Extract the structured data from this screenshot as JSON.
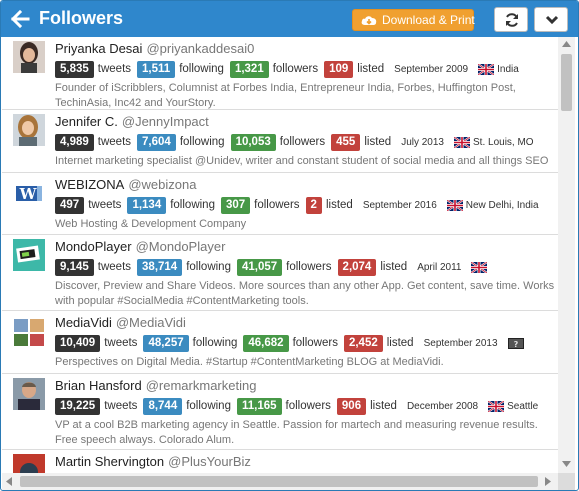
{
  "header": {
    "title": "Followers",
    "download_label": "Download & Print",
    "accent_color": "#2f87cc",
    "download_color": "#f0a030"
  },
  "followers": [
    {
      "name": "Priyanka Desai",
      "handle": "@priyankaddesai0",
      "tweets": "5,835",
      "following": "1,511",
      "followers": "1,321",
      "listed": "109",
      "joined": "September 2009",
      "location": "India",
      "bio": "Founder of iScribblers, Columnist at Forbes India, Entrepreneur India, Forbes, Huffington Post, TechinAsia, Inc42 and YourStory."
    },
    {
      "name": "Jennifer C.",
      "handle": "@JennyImpact",
      "tweets": "4,989",
      "following": "7,604",
      "followers": "10,053",
      "listed": "455",
      "joined": "July 2013",
      "location": "St. Louis, MO",
      "bio": "Internet marketing specialist @Unidev, writer and constant student of social media and all things SEO"
    },
    {
      "name": "WEBIZONA",
      "handle": "@webizona",
      "tweets": "497",
      "following": "1,134",
      "followers": "307",
      "listed": "2",
      "joined": "September 2016",
      "location": "New Delhi, India",
      "bio": "Web Hosting & Development Company"
    },
    {
      "name": "MondoPlayer",
      "handle": "@MondoPlayer",
      "tweets": "9,145",
      "following": "38,714",
      "followers": "41,057",
      "listed": "2,074",
      "joined": "April 2011",
      "location": "",
      "bio": "Discover, Preview and Share Videos. More sources than any other App. Get content, save time. Works with popular #SocialMedia #ContentMarketing tools."
    },
    {
      "name": "MediaVidi",
      "handle": "@MediaVidi",
      "tweets": "10,409",
      "following": "48,257",
      "followers": "46,682",
      "listed": "2,452",
      "joined": "September 2013",
      "location": "",
      "bio": "Perspectives on Digital Media. #Startup #ContentMarketing BLOG at MediaVidi."
    },
    {
      "name": "Brian Hansford",
      "handle": "@remarkmarketing",
      "tweets": "19,225",
      "following": "8,744",
      "followers": "11,165",
      "listed": "906",
      "joined": "December 2008",
      "location": "Seattle",
      "bio": "VP at a cool B2B marketing agency in Seattle. Passion for martech and measuring revenue results. Free speech always. Colorado Alum."
    },
    {
      "name": "Martin Shervington",
      "handle": "@PlusYourBiz"
    }
  ],
  "labels": {
    "tweets": "tweets",
    "following": "following",
    "followers": "followers",
    "listed": "listed"
  }
}
